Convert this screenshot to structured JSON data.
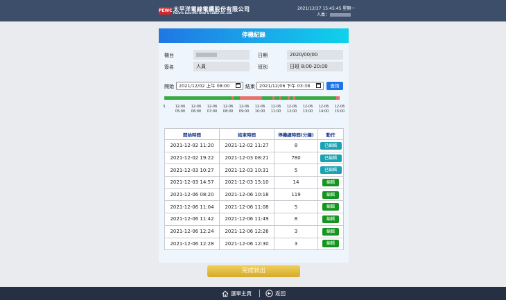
{
  "header": {
    "logo_badge": "PEWC",
    "logo_cn": "太平洋電線電纜股份有限公司",
    "logo_en": "PACIFIC ELECTRIC WIRE & CABLE CO., LTD.",
    "datetime": "2021/12/27  15:45:45  星期一",
    "person_label": "人員："
  },
  "panel": {
    "title": "停機紀錄",
    "machine_label": "機台",
    "date_label": "日期",
    "date_value": "2020/00/00",
    "sign_label": "簽名",
    "sign_value": "人員",
    "shift_label": "班別",
    "shift_value": "日班 8:00-20:00"
  },
  "filter": {
    "start_label": "開始",
    "start_value": "2021/12/02 上午 08:00",
    "end_label": "結束",
    "end_value": "2021/12/06 下午 03:38",
    "query_label": "查詢"
  },
  "timeline": {
    "ticks": [
      {
        "date": "5",
        "time": ""
      },
      {
        "date": "12-06",
        "time": "05:00"
      },
      {
        "date": "12-06",
        "time": "06:00"
      },
      {
        "date": "12-06",
        "time": "07:00"
      },
      {
        "date": "12-06",
        "time": "08:00"
      },
      {
        "date": "12-06",
        "time": "09:00"
      },
      {
        "date": "12-06",
        "time": "10:00"
      },
      {
        "date": "12-06",
        "time": "11:00"
      },
      {
        "date": "12-06",
        "time": "12:00"
      },
      {
        "date": "12-06",
        "time": "13:00"
      },
      {
        "date": "12-06",
        "time": "14:00"
      },
      {
        "date": "12-06",
        "time": "15:00"
      }
    ],
    "running_color": "#3aa843",
    "stopped_color": "#e8706c"
  },
  "table": {
    "headers": [
      "開始時間",
      "結束時間",
      "停機總時間(分鐘)",
      "動作"
    ],
    "rows": [
      {
        "start": "2021-12-02 11:20",
        "end": "2021-12-02 11:27",
        "minutes": "8",
        "action": "已編輯",
        "edited": true
      },
      {
        "start": "2021-12-02 19:22",
        "end": "2021-12-03 08:21",
        "minutes": "780",
        "action": "已編輯",
        "edited": true
      },
      {
        "start": "2021-12-03 10:27",
        "end": "2021-12-03 10:31",
        "minutes": "5",
        "action": "已編輯",
        "edited": true
      },
      {
        "start": "2021-12-03 14:57",
        "end": "2021-12-03 15:10",
        "minutes": "14",
        "action": "編輯",
        "edited": false
      },
      {
        "start": "2021-12-06 08:20",
        "end": "2021-12-06 10:18",
        "minutes": "119",
        "action": "編輯",
        "edited": false
      },
      {
        "start": "2021-12-06 11:04",
        "end": "2021-12-06 11:08",
        "minutes": "5",
        "action": "編輯",
        "edited": false
      },
      {
        "start": "2021-12-06 11:42",
        "end": "2021-12-06 11:49",
        "minutes": "8",
        "action": "編輯",
        "edited": false
      },
      {
        "start": "2021-12-06 12:24",
        "end": "2021-12-06 12:26",
        "minutes": "3",
        "action": "編輯",
        "edited": false
      },
      {
        "start": "2021-12-06 12:28",
        "end": "2021-12-06 12:30",
        "minutes": "3",
        "action": "編輯",
        "edited": false
      }
    ]
  },
  "finish_label": "完成就出",
  "footer": {
    "menu_label": "選單主頁",
    "back_label": "返回"
  }
}
